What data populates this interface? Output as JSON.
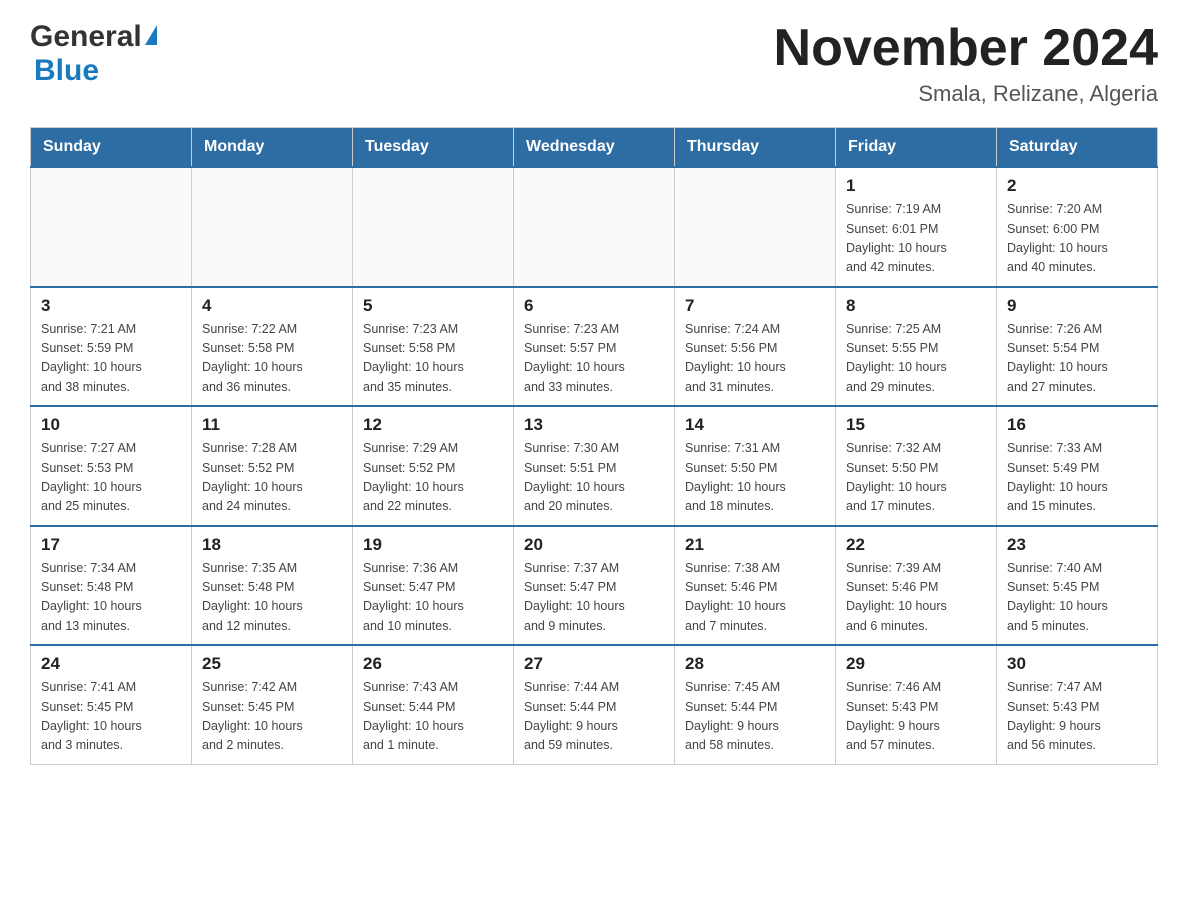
{
  "logo": {
    "general": "General",
    "blue": "Blue",
    "triangle_color": "#1a7abf"
  },
  "header": {
    "month_title": "November 2024",
    "location": "Smala, Relizane, Algeria"
  },
  "weekdays": [
    "Sunday",
    "Monday",
    "Tuesday",
    "Wednesday",
    "Thursday",
    "Friday",
    "Saturday"
  ],
  "weeks": [
    [
      {
        "day": "",
        "info": ""
      },
      {
        "day": "",
        "info": ""
      },
      {
        "day": "",
        "info": ""
      },
      {
        "day": "",
        "info": ""
      },
      {
        "day": "",
        "info": ""
      },
      {
        "day": "1",
        "info": "Sunrise: 7:19 AM\nSunset: 6:01 PM\nDaylight: 10 hours\nand 42 minutes."
      },
      {
        "day": "2",
        "info": "Sunrise: 7:20 AM\nSunset: 6:00 PM\nDaylight: 10 hours\nand 40 minutes."
      }
    ],
    [
      {
        "day": "3",
        "info": "Sunrise: 7:21 AM\nSunset: 5:59 PM\nDaylight: 10 hours\nand 38 minutes."
      },
      {
        "day": "4",
        "info": "Sunrise: 7:22 AM\nSunset: 5:58 PM\nDaylight: 10 hours\nand 36 minutes."
      },
      {
        "day": "5",
        "info": "Sunrise: 7:23 AM\nSunset: 5:58 PM\nDaylight: 10 hours\nand 35 minutes."
      },
      {
        "day": "6",
        "info": "Sunrise: 7:23 AM\nSunset: 5:57 PM\nDaylight: 10 hours\nand 33 minutes."
      },
      {
        "day": "7",
        "info": "Sunrise: 7:24 AM\nSunset: 5:56 PM\nDaylight: 10 hours\nand 31 minutes."
      },
      {
        "day": "8",
        "info": "Sunrise: 7:25 AM\nSunset: 5:55 PM\nDaylight: 10 hours\nand 29 minutes."
      },
      {
        "day": "9",
        "info": "Sunrise: 7:26 AM\nSunset: 5:54 PM\nDaylight: 10 hours\nand 27 minutes."
      }
    ],
    [
      {
        "day": "10",
        "info": "Sunrise: 7:27 AM\nSunset: 5:53 PM\nDaylight: 10 hours\nand 25 minutes."
      },
      {
        "day": "11",
        "info": "Sunrise: 7:28 AM\nSunset: 5:52 PM\nDaylight: 10 hours\nand 24 minutes."
      },
      {
        "day": "12",
        "info": "Sunrise: 7:29 AM\nSunset: 5:52 PM\nDaylight: 10 hours\nand 22 minutes."
      },
      {
        "day": "13",
        "info": "Sunrise: 7:30 AM\nSunset: 5:51 PM\nDaylight: 10 hours\nand 20 minutes."
      },
      {
        "day": "14",
        "info": "Sunrise: 7:31 AM\nSunset: 5:50 PM\nDaylight: 10 hours\nand 18 minutes."
      },
      {
        "day": "15",
        "info": "Sunrise: 7:32 AM\nSunset: 5:50 PM\nDaylight: 10 hours\nand 17 minutes."
      },
      {
        "day": "16",
        "info": "Sunrise: 7:33 AM\nSunset: 5:49 PM\nDaylight: 10 hours\nand 15 minutes."
      }
    ],
    [
      {
        "day": "17",
        "info": "Sunrise: 7:34 AM\nSunset: 5:48 PM\nDaylight: 10 hours\nand 13 minutes."
      },
      {
        "day": "18",
        "info": "Sunrise: 7:35 AM\nSunset: 5:48 PM\nDaylight: 10 hours\nand 12 minutes."
      },
      {
        "day": "19",
        "info": "Sunrise: 7:36 AM\nSunset: 5:47 PM\nDaylight: 10 hours\nand 10 minutes."
      },
      {
        "day": "20",
        "info": "Sunrise: 7:37 AM\nSunset: 5:47 PM\nDaylight: 10 hours\nand 9 minutes."
      },
      {
        "day": "21",
        "info": "Sunrise: 7:38 AM\nSunset: 5:46 PM\nDaylight: 10 hours\nand 7 minutes."
      },
      {
        "day": "22",
        "info": "Sunrise: 7:39 AM\nSunset: 5:46 PM\nDaylight: 10 hours\nand 6 minutes."
      },
      {
        "day": "23",
        "info": "Sunrise: 7:40 AM\nSunset: 5:45 PM\nDaylight: 10 hours\nand 5 minutes."
      }
    ],
    [
      {
        "day": "24",
        "info": "Sunrise: 7:41 AM\nSunset: 5:45 PM\nDaylight: 10 hours\nand 3 minutes."
      },
      {
        "day": "25",
        "info": "Sunrise: 7:42 AM\nSunset: 5:45 PM\nDaylight: 10 hours\nand 2 minutes."
      },
      {
        "day": "26",
        "info": "Sunrise: 7:43 AM\nSunset: 5:44 PM\nDaylight: 10 hours\nand 1 minute."
      },
      {
        "day": "27",
        "info": "Sunrise: 7:44 AM\nSunset: 5:44 PM\nDaylight: 9 hours\nand 59 minutes."
      },
      {
        "day": "28",
        "info": "Sunrise: 7:45 AM\nSunset: 5:44 PM\nDaylight: 9 hours\nand 58 minutes."
      },
      {
        "day": "29",
        "info": "Sunrise: 7:46 AM\nSunset: 5:43 PM\nDaylight: 9 hours\nand 57 minutes."
      },
      {
        "day": "30",
        "info": "Sunrise: 7:47 AM\nSunset: 5:43 PM\nDaylight: 9 hours\nand 56 minutes."
      }
    ]
  ]
}
